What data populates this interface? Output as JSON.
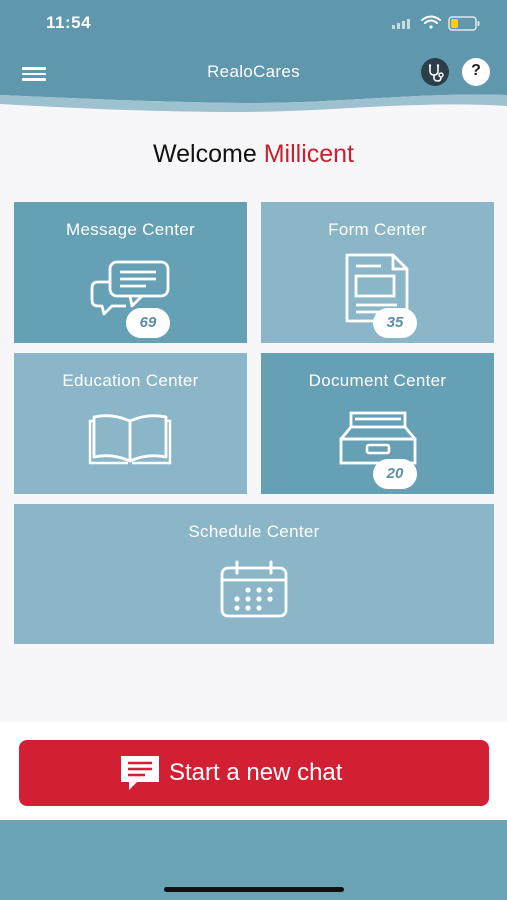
{
  "status_bar": {
    "time": "11:54"
  },
  "header": {
    "title": "RealoCares",
    "help_label": "?",
    "colors": {
      "primary": "#5f97ac",
      "accent": "#d21f33"
    }
  },
  "welcome": {
    "greeting": "Welcome",
    "user_name": "Millicent"
  },
  "tiles": [
    {
      "label": "Message Center",
      "icon": "chat-bubbles-icon",
      "badge": "69"
    },
    {
      "label": "Form Center",
      "icon": "form-document-icon",
      "badge": "35"
    },
    {
      "label": "Education Center",
      "icon": "open-book-icon"
    },
    {
      "label": "Document Center",
      "icon": "file-drawer-icon",
      "badge": "20"
    },
    {
      "label": "Schedule Center",
      "icon": "calendar-icon"
    }
  ],
  "chat_button": {
    "label": "Start a new chat",
    "icon": "chat-message-icon"
  }
}
